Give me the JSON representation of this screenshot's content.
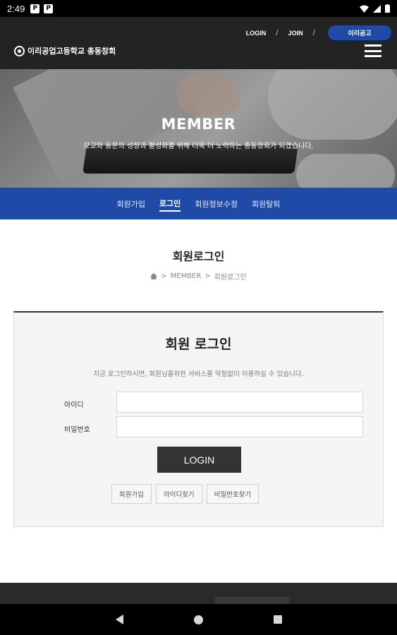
{
  "status_bar": {
    "time": "2:49",
    "icon1": "P",
    "icon2": "P"
  },
  "header": {
    "login_link": "LOGIN",
    "separator": "/",
    "join_link": "JOIN",
    "school_pill": "이리공고",
    "logo_text": "이리공업고등학교 총동창회"
  },
  "hero": {
    "title": "MEMBER",
    "subtitle": "모교와 동문의 성장과 활성화를 위해 더욱 더 노력하는 총동창회가 되겠습니다."
  },
  "subnav": {
    "items": [
      "회원가입",
      "로그인",
      "회원정보수정",
      "회원탈퇴"
    ],
    "active_index": 1
  },
  "page": {
    "title": "회원로그인",
    "breadcrumb": [
      "MEMBER",
      "회원로그인"
    ],
    "breadcrumb_sep": ">"
  },
  "login_box": {
    "title": "회원 로그인",
    "description": "지금 로그인하시면, 회원님을위한 서비스를 막힘없이 이용하실 수 있습니다.",
    "id_label": "아이디",
    "id_value": "",
    "pw_label": "비밀번호",
    "pw_value": "",
    "login_button": "LOGIN",
    "signup_button": "회원가입",
    "find_id_button": "아이디찾기",
    "find_pw_button": "비밀번호찾기"
  },
  "colors": {
    "brand_blue": "#1f4aa8",
    "header_dark": "#232323",
    "button_dark": "#333333"
  }
}
